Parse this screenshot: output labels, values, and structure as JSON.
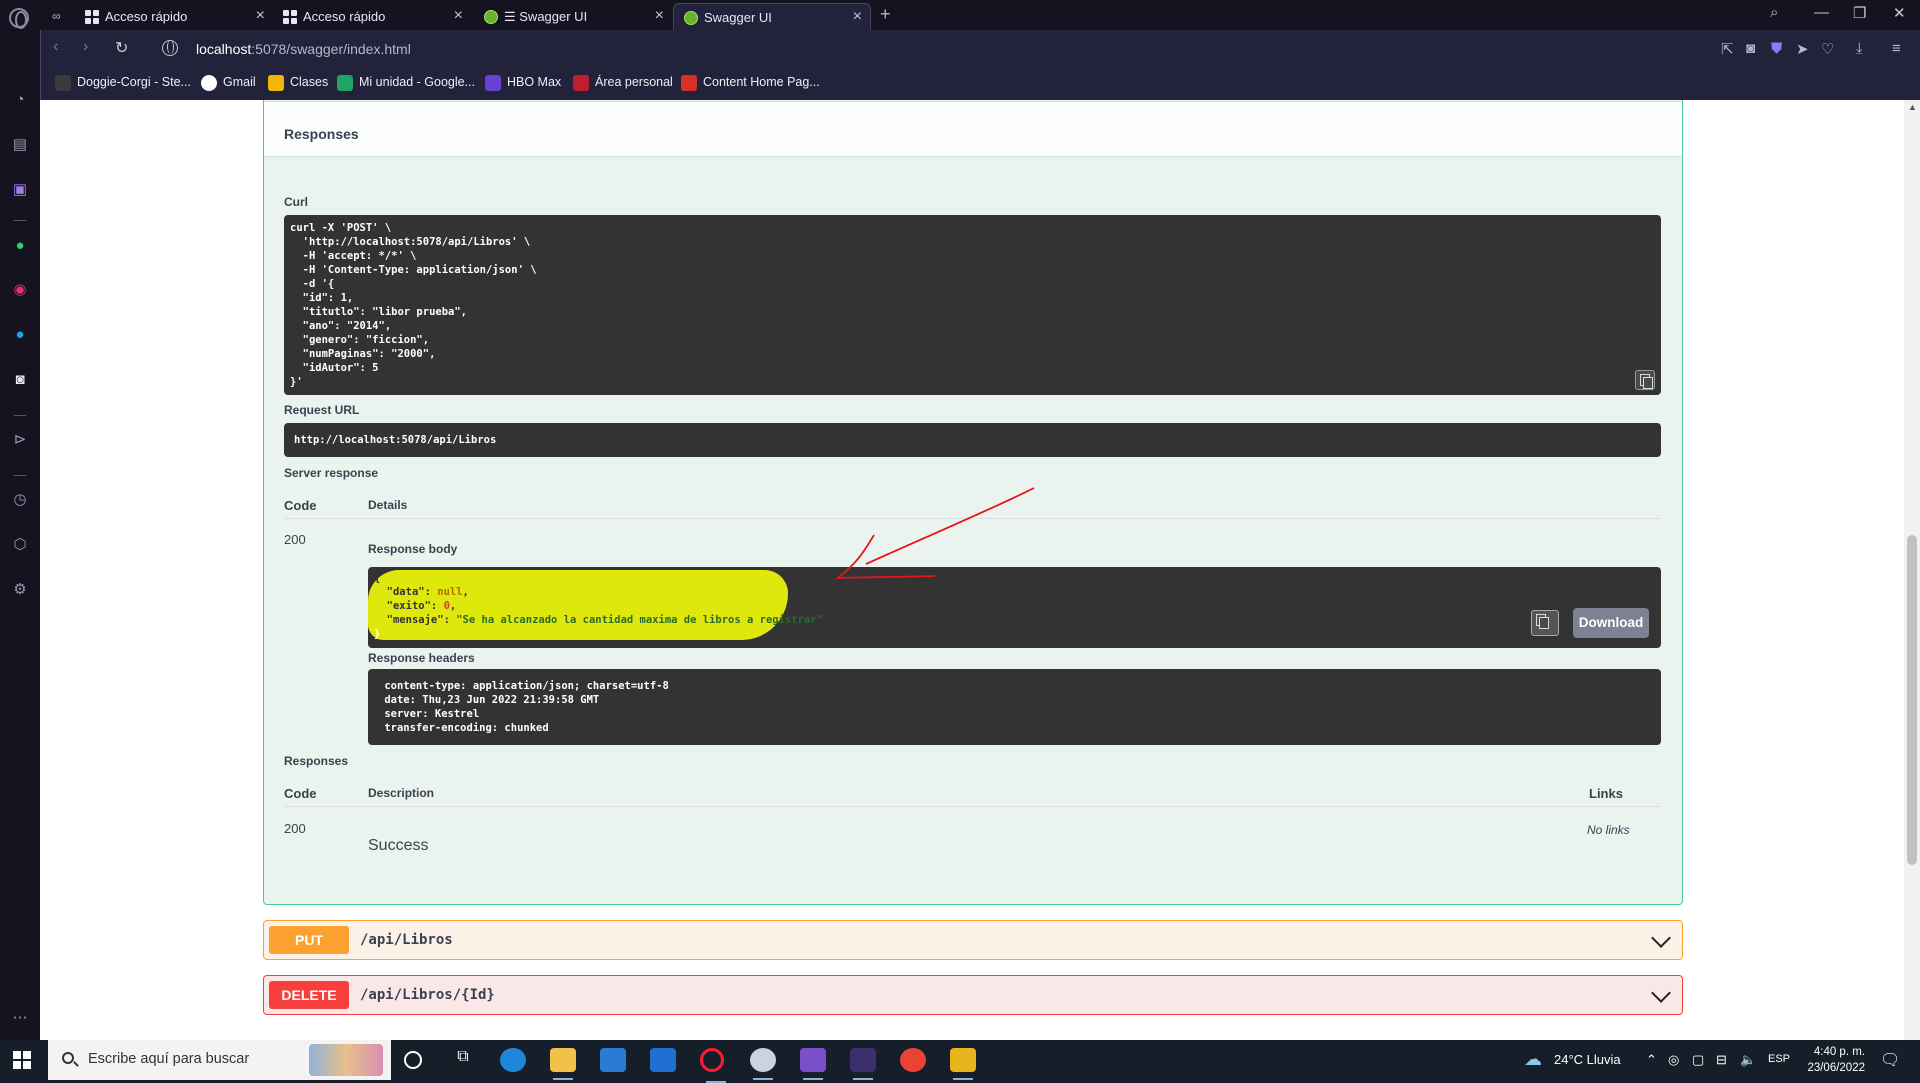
{
  "browser": {
    "tabs": [
      {
        "label": "Acceso rápido",
        "icon": "grid-icon"
      },
      {
        "label": "Acceso rápido",
        "icon": "grid-icon"
      },
      {
        "label": "☰ Swagger UI",
        "icon": "swagger-icon"
      },
      {
        "label": "Swagger UI",
        "icon": "swagger-icon",
        "active": true
      }
    ],
    "url_host": "localhost",
    "url_rest": ":5078/swagger/index.html",
    "bookmarks": [
      {
        "label": "Doggie-Corgi - Ste...",
        "color": "#3a3a3a"
      },
      {
        "label": "Gmail",
        "color": "#ffffff"
      },
      {
        "label": "Clases",
        "color": "#f2b705"
      },
      {
        "label": "Mi unidad - Google...",
        "color": "#1fa463"
      },
      {
        "label": "HBO Max",
        "color": "#6b3fd4"
      },
      {
        "label": "Área personal",
        "color": "#c21d2e"
      },
      {
        "label": "Content Home Pag...",
        "color": "#d7302a"
      }
    ]
  },
  "swagger": {
    "responses_title": "Responses",
    "curl_label": "Curl",
    "curl_text": "curl -X 'POST' \\\n  'http://localhost:5078/api/Libros' \\\n  -H 'accept: */*' \\\n  -H 'Content-Type: application/json' \\\n  -d '{\n  \"id\": 1,\n  \"titutlo\": \"libor prueba\",\n  \"ano\": \"2014\",\n  \"genero\": \"ficcion\",\n  \"numPaginas\": \"2000\",\n  \"idAutor\": 5\n}'",
    "request_url_label": "Request URL",
    "request_url": "http://localhost:5078/api/Libros",
    "server_response_label": "Server response",
    "code_header": "Code",
    "details_header": "Details",
    "response_code": "200",
    "response_body_label": "Response body",
    "response_body": {
      "open": "{",
      "data_key": "\"data\"",
      "data_val": "null",
      "exito_key": "\"exito\"",
      "exito_val": "0",
      "mensaje_key": "\"mensaje\"",
      "mensaje_val": "\"Se ha alcanzado la cantidad maxima de libros a registrar\"",
      "close": "}"
    },
    "download_label": "Download",
    "response_headers_label": "Response headers",
    "response_headers": " content-type: application/json; charset=utf-8 \n date: Thu,23 Jun 2022 21:39:58 GMT \n server: Kestrel \n transfer-encoding: chunked ",
    "responses_label": "Responses",
    "description_header": "Description",
    "links_header": "Links",
    "doc_code": "200",
    "doc_description": "Success",
    "doc_links": "No links"
  },
  "operations": [
    {
      "method": "PUT",
      "path": "/api/Libros"
    },
    {
      "method": "DELETE",
      "path": "/api/Libros/{Id}"
    }
  ],
  "taskbar": {
    "search_placeholder": "Escribe aquí para buscar",
    "weather": "24°C  Lluvia",
    "language": "ESP",
    "time": "4:40 p. m.",
    "date": "23/06/2022"
  },
  "colors": {
    "post_border": "#49cc90",
    "put": "#fca130",
    "delete": "#f93e3e",
    "highlight": "#e9f20b",
    "annotation_arrow": "#e8141b"
  }
}
